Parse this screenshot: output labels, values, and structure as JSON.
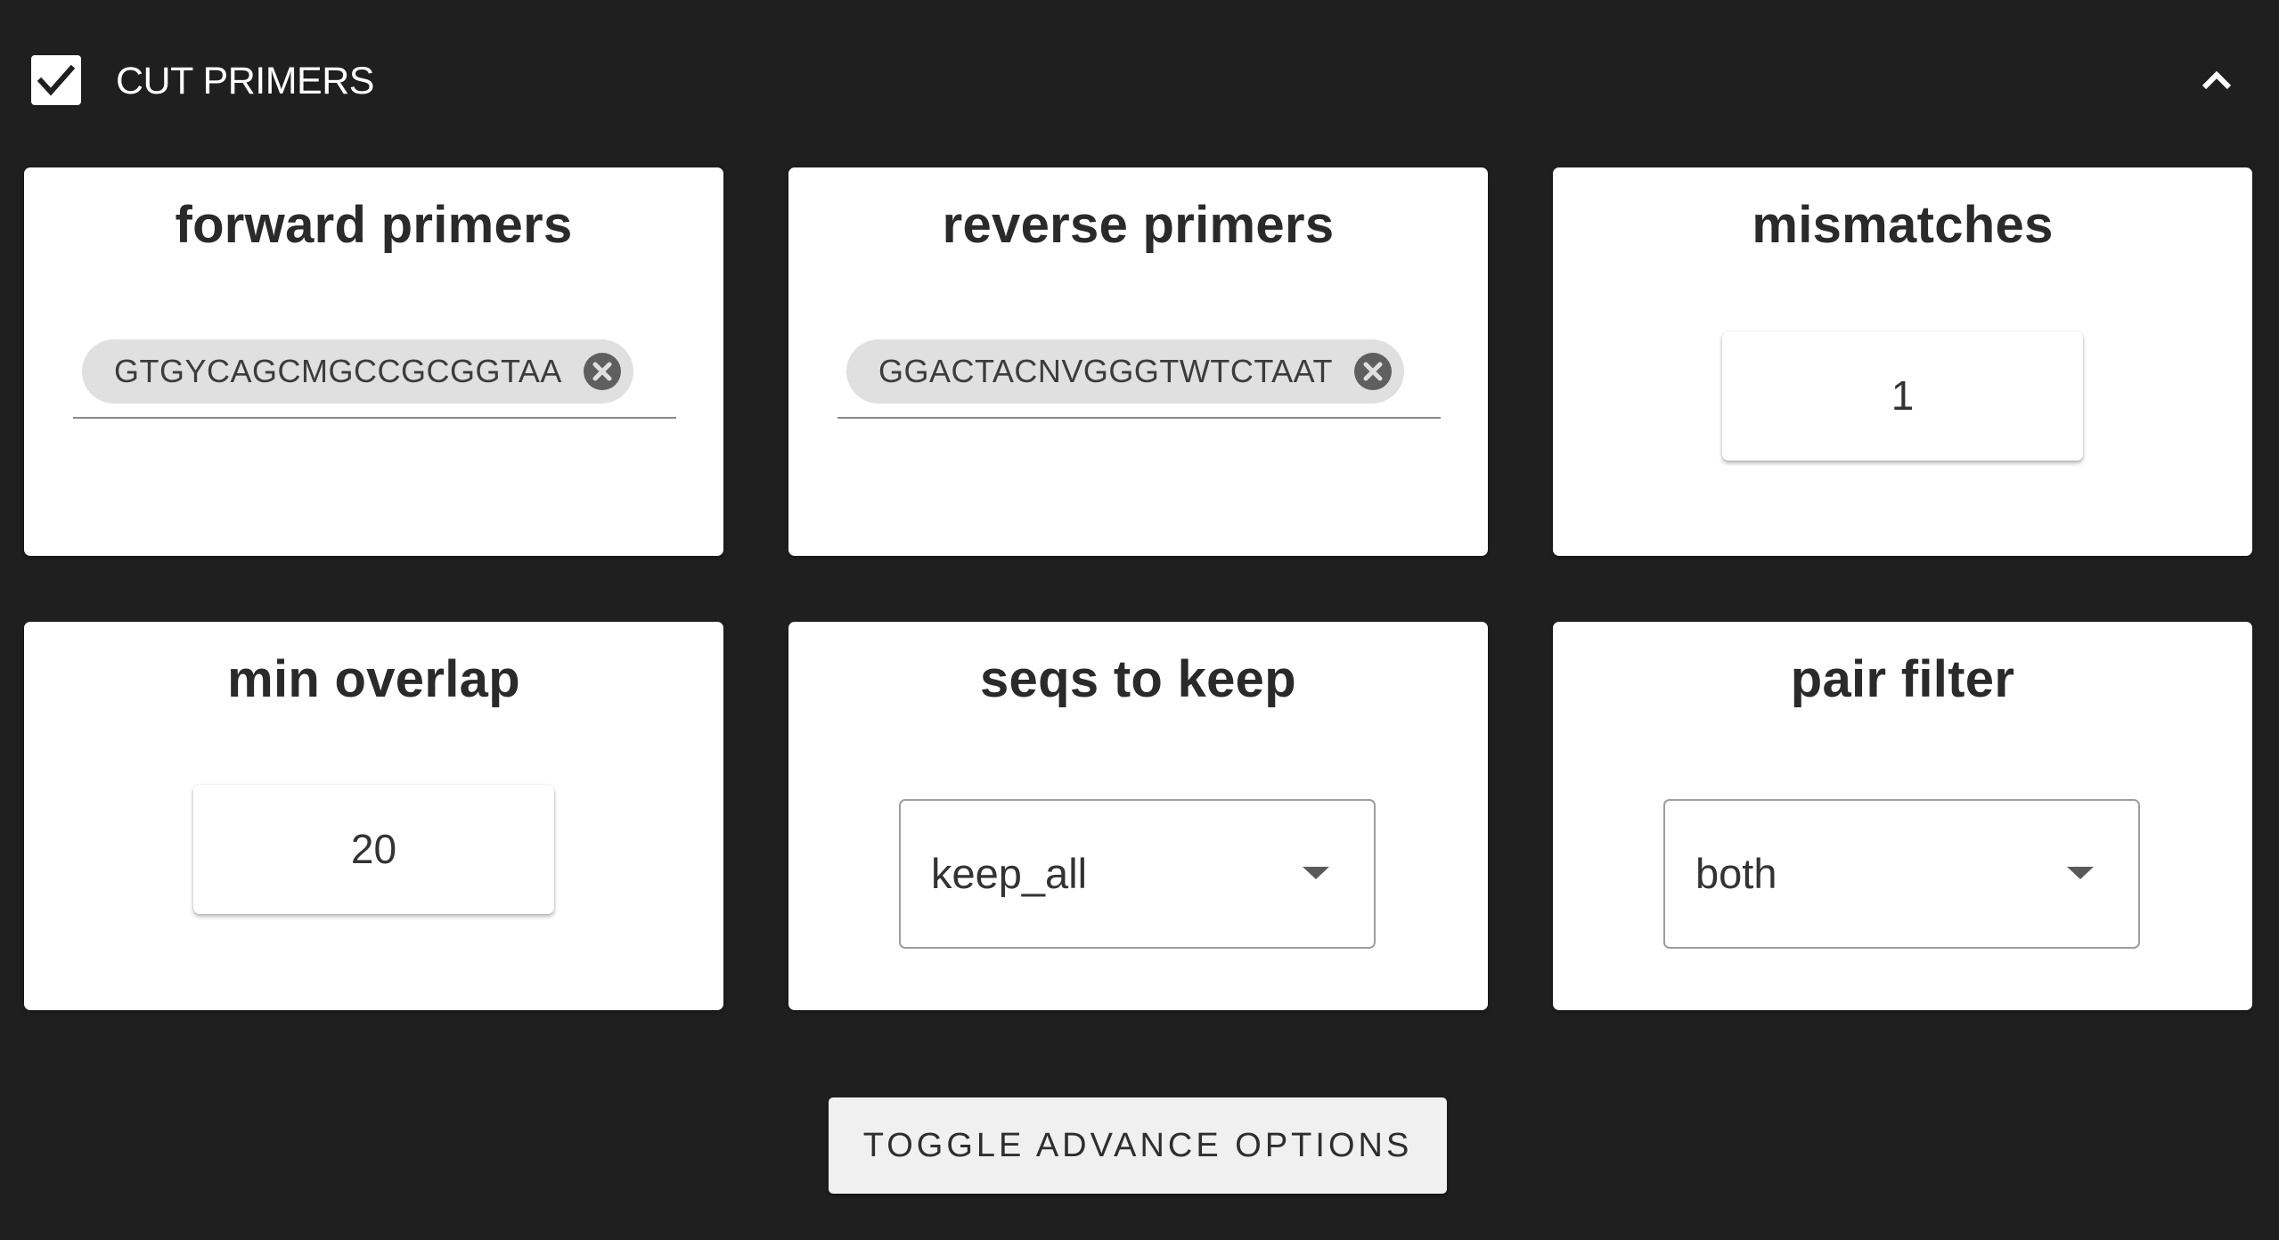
{
  "header": {
    "title": "CUT PRIMERS",
    "checked": true
  },
  "cards": {
    "forward_primers": {
      "title": "forward primers",
      "chips": [
        "GTGYCAGCMGCCGCGGTAA"
      ]
    },
    "reverse_primers": {
      "title": "reverse primers",
      "chips": [
        "GGACTACNVGGGTWTCTAAT"
      ]
    },
    "mismatches": {
      "title": "mismatches",
      "value": "1"
    },
    "min_overlap": {
      "title": "min overlap",
      "value": "20"
    },
    "seqs_to_keep": {
      "title": "seqs to keep",
      "value": "keep_all"
    },
    "pair_filter": {
      "title": "pair filter",
      "value": "both"
    }
  },
  "toggle_button": {
    "label": "TOGGLE ADVANCE OPTIONS"
  },
  "icons": {
    "checkbox": "check-icon",
    "collapse": "chevron-up-icon",
    "chip_remove": "cancel-circle-icon",
    "dropdown": "caret-down-icon"
  },
  "colors": {
    "background": "#1f1f1f",
    "card": "#ffffff",
    "chip": "#e0e0e0",
    "button": "#f0f0f0"
  }
}
